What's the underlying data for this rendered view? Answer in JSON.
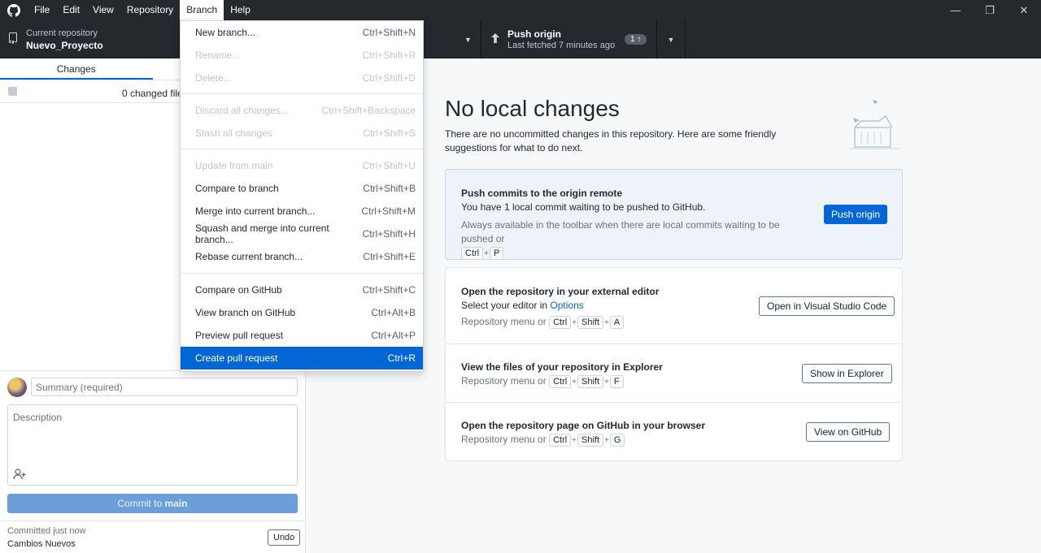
{
  "menubar": {
    "items": [
      "File",
      "Edit",
      "View",
      "Repository",
      "Branch",
      "Help"
    ],
    "open_item": "Branch"
  },
  "window_controls": {
    "minimize": "—",
    "restore": "❐",
    "close": "✕"
  },
  "toolbar": {
    "repo_label": "Current repository",
    "repo_name": "Nuevo_Proyecto",
    "push_title": "Push origin",
    "push_subtitle": "Last fetched 7 minutes ago",
    "push_badge": "1 ↑"
  },
  "sidebar": {
    "tab_changes": "Changes",
    "changed_files": "0 changed file"
  },
  "commit": {
    "summary_placeholder": "Summary (required)",
    "description_placeholder": "Description",
    "button_prefix": "Commit to ",
    "button_branch": "main",
    "last_commit_label": "Committed just now",
    "last_commit_message": "Cambios Nuevos",
    "undo_label": "Undo"
  },
  "main": {
    "title": "No local changes",
    "description": "There are no uncommitted changes in this repository. Here are some friendly suggestions for what to do next.",
    "push_card": {
      "title": "Push commits to the origin remote",
      "text": "You have 1 local commit waiting to be pushed to GitHub.",
      "hint": "Always available in the toolbar when there are local commits waiting to be pushed or",
      "keys": [
        "Ctrl",
        "P"
      ],
      "button": "Push origin"
    },
    "editor_card": {
      "title": "Open the repository in your external editor",
      "text_prefix": "Select your editor in ",
      "text_link": "Options",
      "hint": "Repository menu or",
      "keys": [
        "Ctrl",
        "Shift",
        "A"
      ],
      "button": "Open in Visual Studio Code"
    },
    "explorer_card": {
      "title": "View the files of your repository in Explorer",
      "hint": "Repository menu or",
      "keys": [
        "Ctrl",
        "Shift",
        "F"
      ],
      "button": "Show in Explorer"
    },
    "github_card": {
      "title": "Open the repository page on GitHub in your browser",
      "hint": "Repository menu or",
      "keys": [
        "Ctrl",
        "Shift",
        "G"
      ],
      "button": "View on GitHub"
    }
  },
  "branch_menu": {
    "items": [
      {
        "label": "New branch...",
        "shortcut": "Ctrl+Shift+N",
        "disabled": false
      },
      {
        "label": "Rename...",
        "shortcut": "Ctrl+Shift+R",
        "disabled": true
      },
      {
        "label": "Delete...",
        "shortcut": "Ctrl+Shift+D",
        "disabled": true
      },
      {
        "label": "Discard all changes...",
        "shortcut": "Ctrl+Shift+Backspace",
        "disabled": true
      },
      {
        "label": "Stash all changes",
        "shortcut": "Ctrl+Shift+S",
        "disabled": true
      },
      {
        "label": "Update from main",
        "shortcut": "Ctrl+Shift+U",
        "disabled": true
      },
      {
        "label": "Compare to branch",
        "shortcut": "Ctrl+Shift+B",
        "disabled": false
      },
      {
        "label": "Merge into current branch...",
        "shortcut": "Ctrl+Shift+M",
        "disabled": false
      },
      {
        "label": "Squash and merge into current branch...",
        "shortcut": "Ctrl+Shift+H",
        "disabled": false
      },
      {
        "label": "Rebase current branch...",
        "shortcut": "Ctrl+Shift+E",
        "disabled": false
      },
      {
        "label": "Compare on GitHub",
        "shortcut": "Ctrl+Shift+C",
        "disabled": false
      },
      {
        "label": "View branch on GitHub",
        "shortcut": "Ctrl+Alt+B",
        "disabled": false
      },
      {
        "label": "Preview pull request",
        "shortcut": "Ctrl+Alt+P",
        "disabled": false
      },
      {
        "label": "Create pull request",
        "shortcut": "Ctrl+R",
        "disabled": false,
        "selected": true
      }
    ]
  },
  "colors": {
    "titlebar": "#24292e",
    "accent": "#0366d6",
    "commit_button_disabled": "#6c9fd9"
  }
}
